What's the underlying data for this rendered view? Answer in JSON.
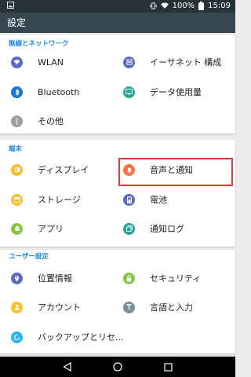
{
  "status_bar": {
    "battery": "100%",
    "time": "15:09"
  },
  "app_bar": {
    "title": "設定"
  },
  "sections": {
    "wireless": {
      "header": "無線とネットワーク",
      "items": [
        {
          "label": "WLAN",
          "icon": "wifi-icon",
          "color": "#5c6bc0"
        },
        {
          "label": "イーサネット 構成",
          "icon": "ethernet-icon",
          "color": "#5c6bc0"
        },
        {
          "label": "Bluetooth",
          "icon": "bluetooth-icon",
          "color": "#1976d2"
        },
        {
          "label": "データ使用量",
          "icon": "data-usage-icon",
          "color": "#26a69a"
        },
        {
          "label": "その他",
          "icon": "more-icon",
          "color": "#9e9e9e"
        }
      ]
    },
    "device": {
      "header": "端末",
      "items": [
        {
          "label": "ディスプレイ",
          "icon": "display-icon",
          "color": "#fbc02d"
        },
        {
          "label": "音声と通知",
          "icon": "bell-icon",
          "color": "#ff7043"
        },
        {
          "label": "ストレージ",
          "icon": "storage-icon",
          "color": "#fbc02d"
        },
        {
          "label": "電池",
          "icon": "battery-icon",
          "color": "#5c6bc0"
        },
        {
          "label": "アプリ",
          "icon": "android-icon",
          "color": "#8bc34a"
        },
        {
          "label": "通知ログ",
          "icon": "notification-log-icon",
          "color": "#26a69a"
        }
      ]
    },
    "user": {
      "header": "ユーザー設定",
      "items": [
        {
          "label": "位置情報",
          "icon": "location-icon",
          "color": "#5c6bc0"
        },
        {
          "label": "セキュリティ",
          "icon": "lock-icon",
          "color": "#8bc34a"
        },
        {
          "label": "アカウント",
          "icon": "account-icon",
          "color": "#fbc02d"
        },
        {
          "label": "言語と入力",
          "icon": "language-icon",
          "color": "#78909c"
        },
        {
          "label": "バックアップとリセ...",
          "icon": "backup-icon",
          "color": "#29b6f6"
        }
      ]
    }
  },
  "highlight_color": "#e53935"
}
